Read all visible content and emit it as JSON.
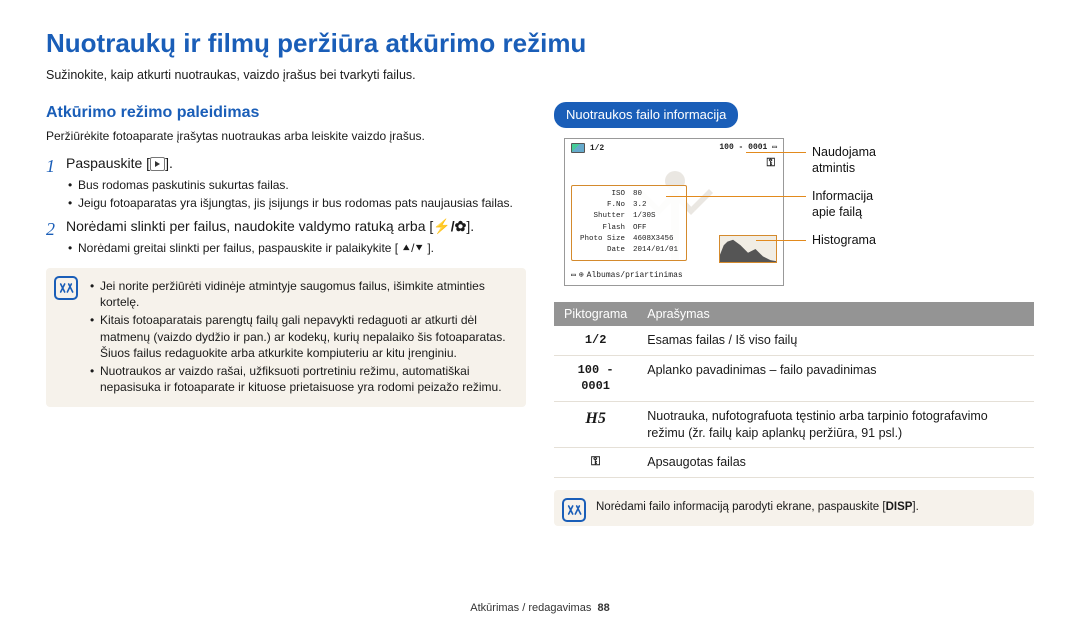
{
  "page": {
    "title": "Nuotraukų ir filmų peržiūra atkūrimo režimu",
    "subtitle": "Sužinokite, kaip atkurti nuotraukas, vaizdo įrašus bei tvarkyti failus."
  },
  "left": {
    "heading": "Atkūrimo režimo paleidimas",
    "subheading": "Peržiūrėkite fotoaparate įrašytas nuotraukas arba leiskite vaizdo įrašus.",
    "steps": [
      {
        "num": "1",
        "text_before": "Paspauskite [",
        "text_after": "].",
        "bullets": [
          "Bus rodomas paskutinis sukurtas failas.",
          "Jeigu fotoaparatas yra išjungtas, jis įsijungs ir bus rodomas pats naujausias failas."
        ]
      },
      {
        "num": "2",
        "text_before": "Norėdami slinkti per failus, naudokite valdymo ratuką arba [",
        "text_after": "].",
        "glyph": "⯅/⯆",
        "bullets": [
          "Norėdami greitai slinkti per failus, paspauskite ir palaikykite [ ⯅/⯆ ]."
        ]
      }
    ],
    "note_bullets": [
      "Jei norite peržiūrėti vidinėje atmintyje saugomus failus, išimkite atminties kortelę.",
      "Kitais fotoaparatais parengtų failų gali nepavykti redaguoti ar atkurti dėl matmenų (vaizdo dydžio ir pan.) ar kodekų, kurių nepalaiko šis fotoaparatas. Šiuos failus redaguokite arba atkurkite kompiuteriu ar kitu įrenginiu.",
      "Nuotraukos ar vaizdo rašai, užfiksuoti portretiniu režimu, automatiškai nepasisuka ir fotoaparate ir kituose prietaisuose yra rodomi peizažo režimu."
    ]
  },
  "right": {
    "pill": "Nuotraukos failo informacija",
    "lcd": {
      "counter": "1/2",
      "folder": "100 - 0001",
      "lock_glyph": "⚿",
      "info_rows": [
        [
          "ISO",
          "80"
        ],
        [
          "F.No",
          "3.2"
        ],
        [
          "Shutter",
          "1/30S"
        ],
        [
          "Flash",
          "OFF"
        ],
        [
          "Photo Size",
          "4608X3456"
        ],
        [
          "Date",
          "2014/01/01"
        ]
      ],
      "bottom_label": "Albumas/priartinimas"
    },
    "callouts": {
      "c1": "Naudojama atmintis",
      "c2": "Informacija apie failą",
      "c3": "Histograma"
    },
    "table": {
      "headers": [
        "Piktograma",
        "Aprašymas"
      ],
      "rows": [
        {
          "icon": "1/2",
          "icon_class": "",
          "desc": "Esamas failas / Iš viso failų"
        },
        {
          "icon": "100 - 0001",
          "icon_class": "",
          "desc": "Aplanko pavadinimas – failo pavadinimas"
        },
        {
          "icon": "H5",
          "icon_class": "serif",
          "desc": "Nuotrauka, nufotografuota tęstinio arba tarpinio fotografavimo režimu (žr. failų kaip aplankų peržiūra, 91 psl.)"
        },
        {
          "icon": "⚿",
          "icon_class": "",
          "desc": "Apsaugotas failas"
        }
      ]
    },
    "tip_before": "Norėdami failo informaciją parodyti ekrane, paspauskite [",
    "tip_key": "DISP",
    "tip_after": "]."
  },
  "footer": {
    "section": "Atkūrimas / redagavimas",
    "page": "88"
  }
}
